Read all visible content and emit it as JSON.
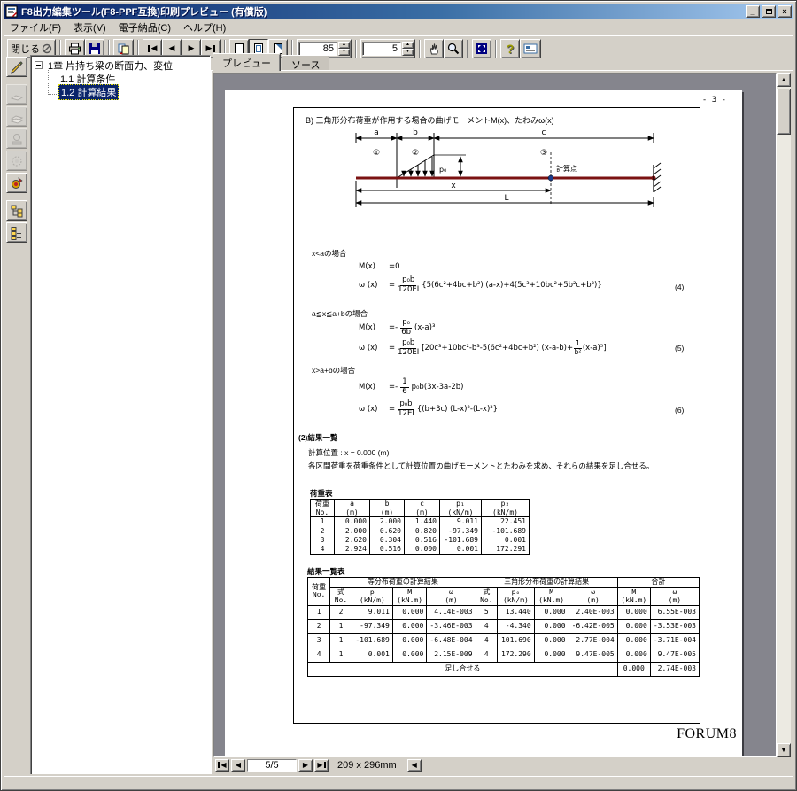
{
  "window": {
    "title": "F8出力編集ツール(F8-PPF互換)印刷プレビュー (有償版)",
    "minimize": "_",
    "close": "×"
  },
  "menu": {
    "items": [
      "ファイル(F)",
      "表示(V)",
      "電子納品(C)",
      "ヘルプ(H)"
    ]
  },
  "toolbar": {
    "close_label": "閉じる",
    "zoom_value": "85",
    "page_value": "5"
  },
  "tabs": {
    "preview": "プレビュー",
    "source": "ソース"
  },
  "tree": {
    "root": "1章 片持ち梁の断面力、変位",
    "children": [
      {
        "label": "1.1 計算条件"
      },
      {
        "label": "1.2 計算結果"
      }
    ]
  },
  "page": {
    "page_no": "- 3 -",
    "heading": "B) 三角形分布荷重が作用する場合の曲げモーメントM(x)、たわみω(x)",
    "brand": "FORUM8",
    "diagram": {
      "a": "a",
      "b": "b",
      "c": "c",
      "s1": "①",
      "s2": "②",
      "s3": "③",
      "p0": "p₀",
      "calc_point": "計算点",
      "x": "x",
      "L": "L"
    },
    "formulas": [
      {
        "case_label": "x<aの場合",
        "m_lhs": "M(x)",
        "m_rhs": "=0",
        "w_lhs": "ω (x)",
        "w_eq": "=",
        "w_num": "p₀b",
        "w_den": "120EI",
        "w_rest": "{5(6c²+4bc+b²) (a-x)+4(5c³+10bc²+5b²c+b³)}",
        "eq_no": "(4)"
      },
      {
        "case_label": "a≦x≦a+bの場合",
        "m_lhs": "M(x)",
        "m_eq": "=-",
        "m_num": "p₀",
        "m_den": "6b",
        "m_rest": "(x-a)³",
        "w_lhs": "ω (x)",
        "w_eq": "=",
        "w_num": "p₀b",
        "w_den": "120EI",
        "w_rest1": "[20c³+10bc²-b³-5(6c²+4bc+b²) (x-a-b)+",
        "w_inner_num": "1",
        "w_inner_den": "b²",
        "w_rest2": "(x-a)⁵]",
        "eq_no": "(5)"
      },
      {
        "case_label": "x>a+bの場合",
        "m_lhs": "M(x)",
        "m_eq": "=-",
        "m_num": "1",
        "m_den": "6",
        "m_rest": "p₀b(3x-3a-2b)",
        "w_lhs": "ω (x)",
        "w_eq": "=",
        "w_num": "p₀b",
        "w_den": "12EI",
        "w_rest": "{(b+3c) (L-x)²-(L-x)³}",
        "eq_no": "(6)"
      }
    ],
    "section2": {
      "title": "(2)結果一覧",
      "calc_pos": "計算位置 : x = 0.000 (m)",
      "desc": "各区間荷重を荷重条件として計算位置の曲げモーメントとたわみを求め、それらの結果を足し合せる。"
    },
    "load_table": {
      "title": "荷重表",
      "headers": [
        [
          "荷重",
          "No."
        ],
        [
          "a",
          "(m)"
        ],
        [
          "b",
          "(m)"
        ],
        [
          "c",
          "(m)"
        ],
        [
          "p₁",
          "(kN/m)"
        ],
        [
          "p₂",
          "(kN/m)"
        ]
      ],
      "rows": [
        [
          "1",
          "0.000",
          "2.000",
          "1.440",
          "9.011",
          "22.451"
        ],
        [
          "2",
          "2.000",
          "0.620",
          "0.820",
          "-97.349",
          "-101.689"
        ],
        [
          "3",
          "2.620",
          "0.304",
          "0.516",
          "-101.689",
          "0.001"
        ],
        [
          "4",
          "2.924",
          "0.516",
          "0.000",
          "0.001",
          "172.291"
        ]
      ]
    },
    "result_table": {
      "title": "結果一覧表",
      "col_load_no": [
        "荷重",
        "No."
      ],
      "group_uniform": "等分布荷重の計算結果",
      "group_triangle": "三角形分布荷重の計算結果",
      "group_total": "合計",
      "sub_headers": [
        [
          "式",
          "No."
        ],
        [
          "p",
          "(kN/m)"
        ],
        [
          "M",
          "(kN.m)"
        ],
        [
          "ω",
          "(m)"
        ],
        [
          "式",
          "No."
        ],
        [
          "p₀",
          "(kN/m)"
        ],
        [
          "M",
          "(kN.m)"
        ],
        [
          "ω",
          "(m)"
        ],
        [
          "M",
          "(kN.m)"
        ],
        [
          "ω",
          "(m)"
        ]
      ],
      "rows": [
        [
          "1",
          "2",
          "9.011",
          "0.000",
          "4.14E-003",
          "5",
          "13.440",
          "0.000",
          "2.40E-003",
          "0.000",
          "6.55E-003"
        ],
        [
          "2",
          "1",
          "-97.349",
          "0.000",
          "-3.46E-003",
          "4",
          "-4.340",
          "0.000",
          "-6.42E-005",
          "0.000",
          "-3.53E-003"
        ],
        [
          "3",
          "1",
          "-101.689",
          "0.000",
          "-6.48E-004",
          "4",
          "101.690",
          "0.000",
          "2.77E-004",
          "0.000",
          "-3.71E-004"
        ],
        [
          "4",
          "1",
          "0.001",
          "0.000",
          "2.15E-009",
          "4",
          "172.290",
          "0.000",
          "9.47E-005",
          "0.000",
          "9.47E-005"
        ]
      ],
      "footer_label": "足し合せる",
      "footer_m": "0.000",
      "footer_w": "2.74E-003"
    }
  },
  "navbar": {
    "page_indicator": "5/5",
    "paper_size": "209 x 296mm"
  }
}
